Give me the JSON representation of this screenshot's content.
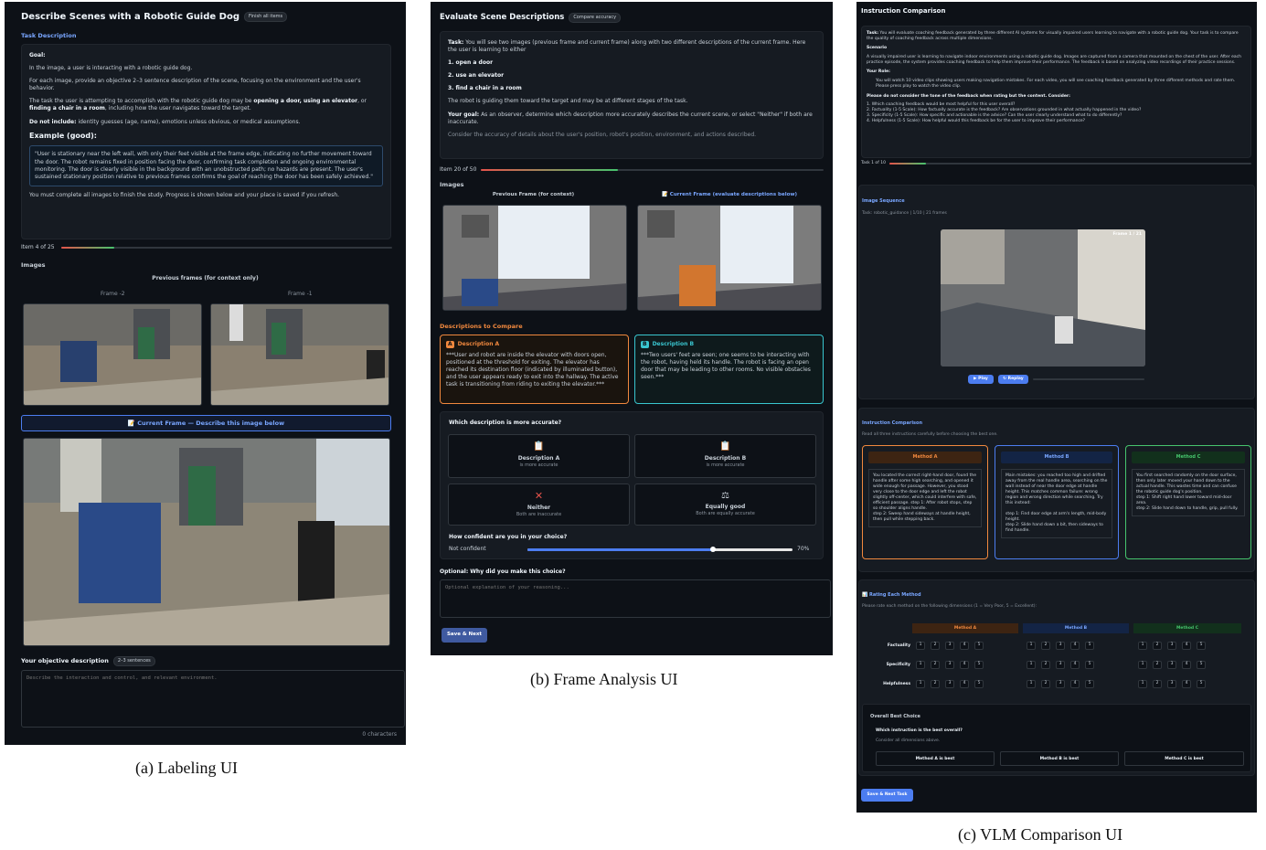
{
  "a": {
    "title": "Describe Scenes with a Robotic Guide Dog",
    "title_tag": "Finish all items",
    "task_heading": "Task Description",
    "goal_label": "Goal:",
    "p1": "In the image, a user is interacting with a robotic guide dog.",
    "p2": "For each image, provide an objective 2–3 sentence description of the scene, focusing on the environment and the user's behavior.",
    "p3a": "The task the user is attempting to accomplish with the robotic guide dog may be ",
    "p3b": "opening a door, using an elevator",
    "p3c": ", or ",
    "p3d": "finding a chair in a room",
    "p3e": ", including how the user navigates toward the target.",
    "p4a": "Do not include:",
    "p4b": " identity guesses (age, name), emotions unless obvious, or medical assumptions.",
    "example_label": "Example (good):",
    "example": "\"User is stationary near the left wall, with only their feet visible at the frame edge, indicating no further movement toward the door. The robot remains fixed in position facing the door, confirming task completion and ongoing environmental monitoring. The door is clearly visible in the background with an unobstructed path; no hazards are present. The user's sustained stationary position relative to previous frames confirms the goal of reaching the door has been safely achieved.\"",
    "p5": "You must complete all images to finish the study. Progress is shown below and your place is saved if you refresh.",
    "item": "Item 4 of 25",
    "progress": 0.16,
    "images_heading": "Images",
    "prev_label": "Previous frames (for context only)",
    "frame_m2": "Frame -2",
    "frame_m1": "Frame -1",
    "current_banner": "📝 Current Frame — Describe this image below",
    "desc_label": "Your objective description",
    "desc_tag": "2–3 sentences",
    "desc_placeholder": "Describe the interaction and control, and relevant environment.",
    "char_count": "0 characters"
  },
  "b": {
    "title": "Evaluate Scene Descriptions",
    "title_tag": "Compare accuracy",
    "task_a": "Task:",
    "task_b": " You will see two images (previous frame and current frame) along with two different descriptions of the current frame. Here the user is learning to either",
    "o1": "1. open a door",
    "o2": "2. use an elevator",
    "o3": "3. find a chair in a room",
    "p2": "The robot is guiding them toward the target and may be at different stages of the task.",
    "goal_a": "Your goal:",
    "goal_b": " As an observer, determine which description more accurately describes the current scene, or select \"Neither\" if both are inaccurate.",
    "p3": "Consider the accuracy of details about the user's position, robot's position, environment, and actions described.",
    "item": "Item 20 of 50",
    "progress": 0.4,
    "images_heading": "Images",
    "prev_label": "Previous Frame (for context)",
    "curr_label": "📝 Current Frame (evaluate descriptions below)",
    "compare_heading": "Descriptions to Compare",
    "desc_a_label": "Description A",
    "desc_a_letter": "A",
    "desc_a": "***User and robot are inside the elevator with doors open, positioned at the threshold for exiting. The elevator has reached its destination floor (indicated by illuminated button), and the user appears ready to exit into the hallway. The active task is transitioning from riding to exiting the elevator.***",
    "desc_b_label": "Description B",
    "desc_b_letter": "B",
    "desc_b": "***Two users' feet are seen; one seems to be interacting with the robot, having held its handle. The robot is facing an open door that may be leading to other rooms. No visible obstacles seen.***",
    "question": "Which description is more accurate?",
    "c1_t": "Description A",
    "c1_s": "is more accurate",
    "c2_t": "Description B",
    "c2_s": "is more accurate",
    "c3_t": "Neither",
    "c3_s": "Both are inaccurate",
    "c4_t": "Equally good",
    "c4_s": "Both are equally accurate",
    "conf_q": "How confident are you in your choice?",
    "conf_left": "Not confident",
    "conf_val": "70%",
    "confidence": 0.7,
    "opt_q": "Optional: Why did you make this choice?",
    "opt_placeholder": "Optional explanation of your reasoning...",
    "save": "Save & Next"
  },
  "c": {
    "title": "Instruction Comparison",
    "task_a": "Task:",
    "task_b": " You will evaluate coaching feedback generated by three different AI systems for visually impaired users learning to navigate with a robotic guide dog. Your task is to compare the quality of coaching feedback across multiple dimensions.",
    "scenario_label": "Scenario",
    "scenario": "A visually impaired user is learning to navigate indoor environments using a robotic guide dog. Images are captured from a camera that mounted on the chest of the user. After each practice episode, the system provides coaching feedback to help them improve their performance. The feedback is based on analyzing video recordings of their practice sessions.",
    "role_label": "Your Role:",
    "role": "You will watch 10 video clips showing users making navigation mistakes. For each video, you will see coaching feedback generated by three different methods and rate them. Please press play to watch the video clip.",
    "note": "Please do not consider the tone of the feedback when rating but the content. Consider:",
    "list": [
      "1. Which coaching feedback would be most helpful for this user overall?",
      "2. Factuality (1-5 Scale): How factually accurate is the feedback? Are observations grounded in what actually happened in the video?",
      "3. Specificity (1-5 Scale): How specific and actionable is the advice? Can the user clearly understand what to do differently?",
      "4. Helpfulness (1-5 Scale): How helpful would this feedback be for the user to improve their performance?"
    ],
    "task_count": "Task 1 of 10",
    "progress": 0.1,
    "seq_heading": "Image Sequence",
    "seq_sub": "Task: robotic_guidance | 1/10 | 21 frames",
    "frame_label": "Frame 1 / 21",
    "play": "▶ Play",
    "replay": "↻ Replay",
    "cmp_heading": "Instruction Comparison",
    "cmp_sub": "Read all three instructions carefully before choosing the best one.",
    "mA": "Method A",
    "mB": "Method B",
    "mC": "Method C",
    "mA_text": "You located the correct right-hand door, found the handle after some high searching, and opened it wide enough for passage. However, you stood very close to the door edge and left the robot slightly off-center, which could interfere with safe, efficient passage. step 1: After robot stops, step so shoulder aligns handle.\nstep 2: Sweep hand sideways at handle height, then pull while stepping back.",
    "mB_text": "Main mistakes: you reached too high and drifted away from the real handle area, searching on the wall instead of near the door edge at handle height. This matches common failure: wrong region and wrong direction while searching. Try this instead:\n\nstep 1: Find door edge at arm's length, mid-body height.\nstep 2: Slide hand down a bit, then sideways to find handle.",
    "mC_text": "You first searched randomly on the door surface, then only later moved your hand down to the actual handle. This wastes time and can confuse the robotic guide dog's position.\nstep 1: Shift right hand lower toward mid-door area.\nstep 2: Slide hand down to handle, grip, pull fully.",
    "rate_heading": "📊 Rating Each Method",
    "rate_sub": "Please rate each method on the following dimensions (1 = Very Poor, 5 = Excellent):",
    "dims": [
      "Factuality",
      "Specificity",
      "Helpfulness"
    ],
    "scale": [
      "1",
      "2",
      "3",
      "4",
      "5"
    ],
    "best_heading": "Overall Best Choice",
    "best_q": "Which instruction is the best overall?",
    "best_sub": "Consider all dimensions above.",
    "bA": "Method A is best",
    "bB": "Method B is best",
    "bC": "Method C is best",
    "save": "Save & Next Task"
  },
  "captions": {
    "a": "(a) Labeling UI",
    "b": "(b) Frame Analysis UI",
    "c": "(c) VLM Comparison UI"
  },
  "colors": {
    "bg": "#0d1117",
    "accent": "#4c7df0",
    "orange": "#f0883e",
    "cyan": "#39c5cf",
    "green": "#46c46d"
  },
  "icons": {
    "clipboard": "clipboard-icon",
    "cross": "cross-icon",
    "scale": "scale-icon"
  }
}
